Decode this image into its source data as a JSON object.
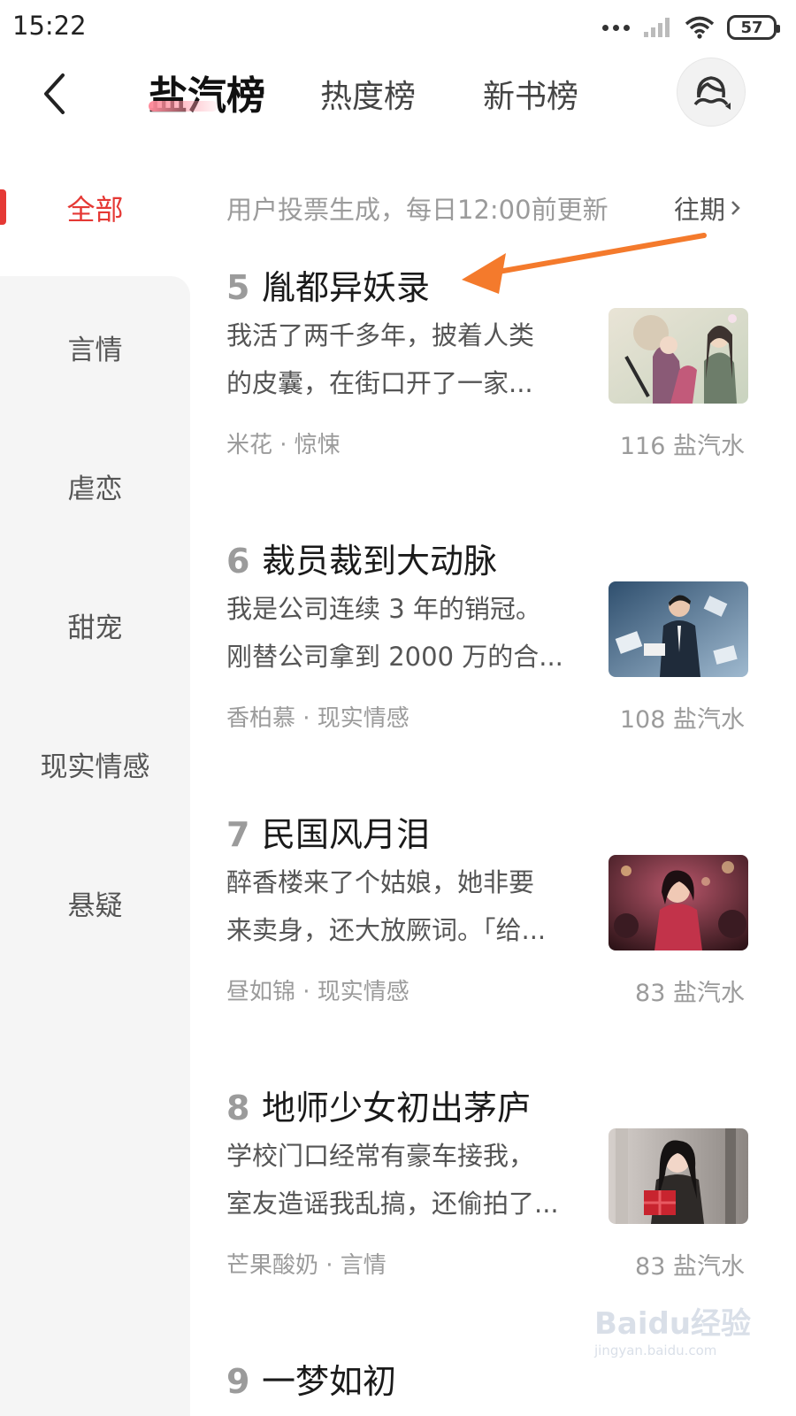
{
  "status_bar": {
    "time": "15:22",
    "battery": "57"
  },
  "header": {
    "tabs": [
      {
        "label": "盐汽榜"
      },
      {
        "label": "热度榜"
      },
      {
        "label": "新书榜"
      }
    ]
  },
  "sidebar": {
    "items": [
      {
        "label": "全部"
      },
      {
        "label": "言情"
      },
      {
        "label": "虐恋"
      },
      {
        "label": "甜宠"
      },
      {
        "label": "现实情感"
      },
      {
        "label": "悬疑"
      }
    ],
    "active_color": "#e53935"
  },
  "list_header": {
    "subtitle": "用户投票生成，每日12:00前更新",
    "history_label": "往期"
  },
  "books": [
    {
      "rank": "5",
      "title": "胤都异妖录",
      "desc_line1": "我活了两千多年，披着人类",
      "desc_line2": "的皮囊，在街口开了一家...",
      "meta": "米花 · 惊悚",
      "score": "116 盐汽水"
    },
    {
      "rank": "6",
      "title": "裁员裁到大动脉",
      "desc_line1": "我是公司连续 3 年的销冠。",
      "desc_line2": "刚替公司拿到 2000 万的合...",
      "meta": "香柏慕 · 现实情感",
      "score": "108 盐汽水"
    },
    {
      "rank": "7",
      "title": "民国风月泪",
      "desc_line1": "醉香楼来了个姑娘，她非要",
      "desc_line2": "来卖身，还大放厥词。「给...",
      "meta": "昼如锦 · 现实情感",
      "score": "83 盐汽水"
    },
    {
      "rank": "8",
      "title": "地师少女初出茅庐",
      "desc_line1": "学校门口经常有豪车接我，",
      "desc_line2": "室友造谣我乱搞，还偷拍了...",
      "meta": "芒果酸奶 · 言情",
      "score": "83 盐汽水"
    },
    {
      "rank": "9",
      "title": "一梦如初"
    }
  ],
  "watermark": {
    "text": "Baidu经验",
    "url": "jingyan.baidu.com"
  },
  "colors": {
    "accent_red": "#e53935",
    "annotation_arrow": "#f47a2c"
  }
}
